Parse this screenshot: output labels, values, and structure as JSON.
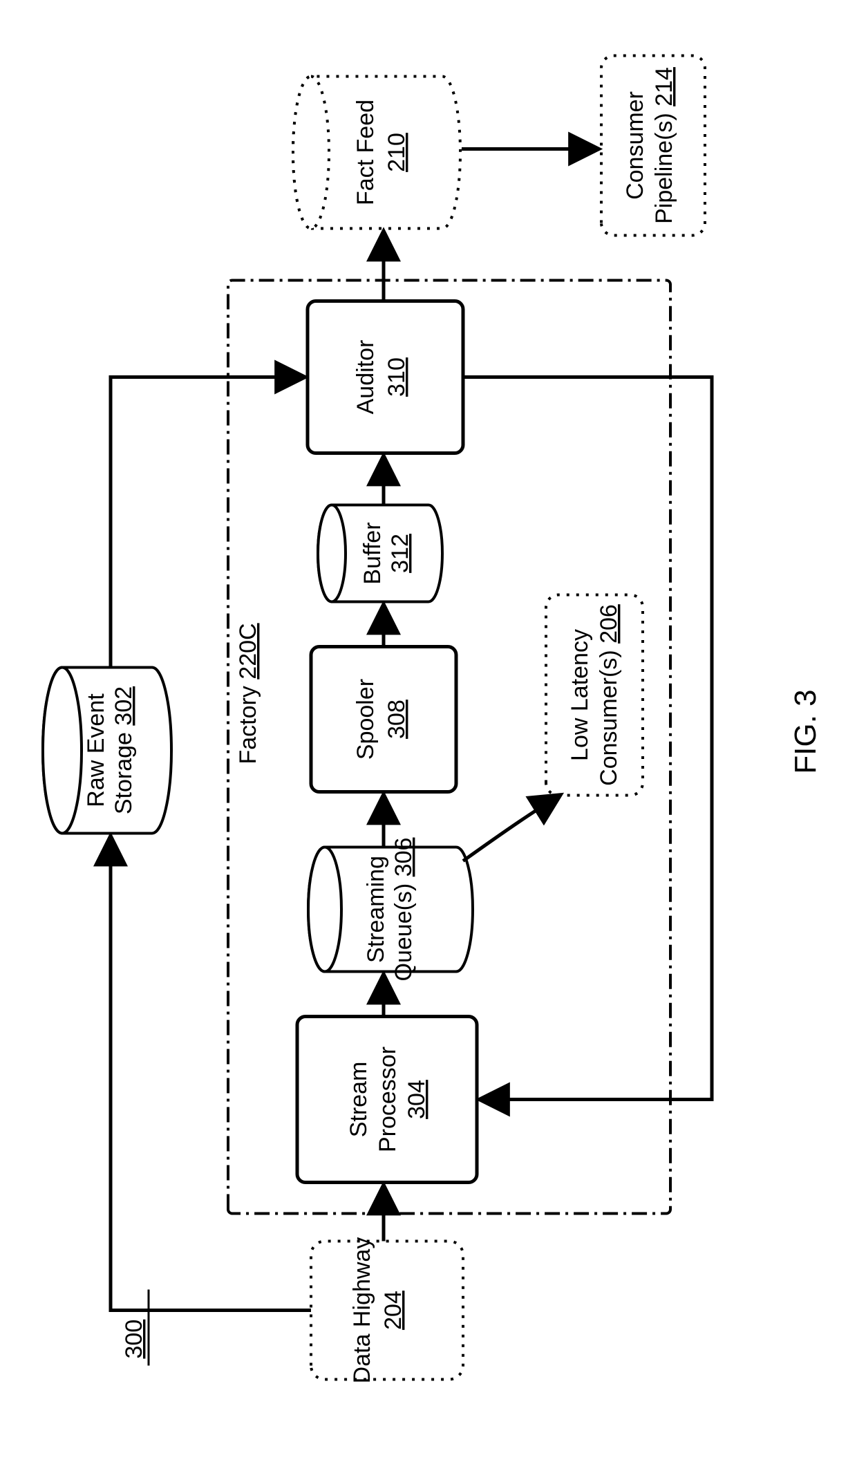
{
  "figure": {
    "caption": "FIG. 3",
    "overall_ref": "300"
  },
  "nodes": {
    "data_highway": {
      "label": "Data Highway",
      "ref": "204"
    },
    "raw_event_storage": {
      "label_line1": "Raw Event",
      "label_line2": "Storage",
      "ref": "302"
    },
    "factory": {
      "label": "Factory",
      "ref": "220C"
    },
    "stream_processor": {
      "label_line1": "Stream",
      "label_line2": "Processor",
      "ref": "304"
    },
    "streaming_queues": {
      "label_line1": "Streaming",
      "label_line2": "Queue(s)",
      "ref": "306"
    },
    "spooler": {
      "label": "Spooler",
      "ref": "308"
    },
    "buffer": {
      "label": "Buffer",
      "ref": "312"
    },
    "auditor": {
      "label": "Auditor",
      "ref": "310"
    },
    "low_latency_consumers": {
      "label_line1": "Low Latency",
      "label_line2": "Consumer(s)",
      "ref": "206"
    },
    "fact_feed": {
      "label": "Fact Feed",
      "ref": "210"
    },
    "consumer_pipelines": {
      "label_line1": "Consumer",
      "label_line2": "Pipeline(s)",
      "ref": "214"
    }
  }
}
